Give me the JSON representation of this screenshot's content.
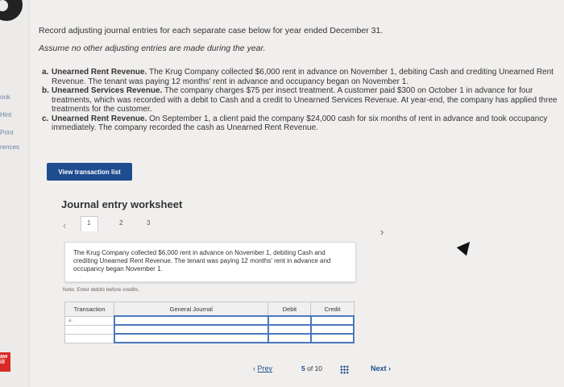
{
  "sidebar": {
    "items": [
      "ook",
      "Hint",
      "Print",
      "rences"
    ],
    "badge": "aw ill"
  },
  "intro": {
    "line1": "Record adjusting journal entries for each separate case below for year ended December 31.",
    "line2": "Assume no other adjusting entries are made during the year."
  },
  "cases": [
    {
      "letter": "a.",
      "title": "Unearned Rent Revenue.",
      "text": " The Krug Company collected $6,000 rent in advance on November 1, debiting Cash and crediting Unearned Rent Revenue. The tenant was paying 12 months' rent in advance and occupancy began on November 1."
    },
    {
      "letter": "b.",
      "title": "Unearned Services Revenue.",
      "text": " The company charges $75 per insect treatment. A customer paid $300 on October 1 in advance for four treatments, which was recorded with a debit to Cash and a credit to Unearned Services Revenue. At year-end, the company has applied three treatments for the customer."
    },
    {
      "letter": "c.",
      "title": "Unearned Rent Revenue.",
      "text": " On September 1, a client paid the company $24,000 cash for six months of rent in advance and took occupancy immediately. The company recorded the cash as Unearned Rent Revenue."
    }
  ],
  "view_button": "View transaction list",
  "worksheet": {
    "title": "Journal entry worksheet",
    "pages": [
      "1",
      "2",
      "3"
    ],
    "description": "The Krug Company collected $6,000 rent in advance on November 1, debiting Cash and crediting Unearned Rent Revenue. The tenant was paying 12 months' rent in advance and occupancy began November 1.",
    "note": "Note: Enter debits before credits.",
    "columns": [
      "Transaction",
      "General Journal",
      "Debit",
      "Credit"
    ],
    "row_label": "a."
  },
  "nav": {
    "prev": "Prev",
    "current": "5",
    "of": "of",
    "total": "10",
    "next": "Next"
  }
}
